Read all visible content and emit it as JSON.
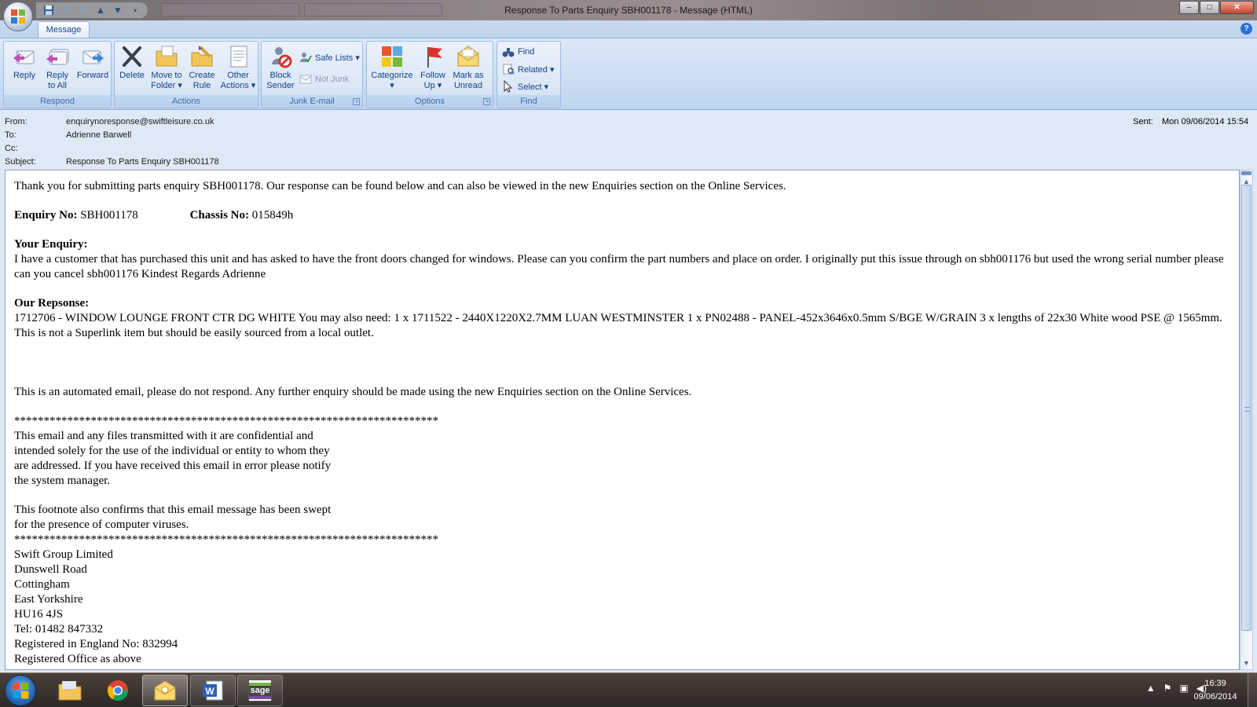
{
  "window": {
    "title": "Response To Parts Enquiry SBH001178 - Message (HTML)",
    "controls": {
      "minimize": "–",
      "maximize": "□",
      "close": "✕"
    }
  },
  "quick_access": {
    "icons": [
      "save-icon",
      "undo-icon",
      "redo-icon",
      "previous-item-icon",
      "next-item-icon",
      "customize-dropdown-icon"
    ]
  },
  "ribbon": {
    "tab": "Message",
    "help": "?",
    "groups": {
      "respond": {
        "label": "Respond",
        "reply": "Reply",
        "reply_all_1": "Reply",
        "reply_all_2": "to All",
        "forward": "Forward"
      },
      "actions": {
        "label": "Actions",
        "delete": "Delete",
        "move_1": "Move to",
        "move_2": "Folder ▾",
        "create_1": "Create",
        "create_2": "Rule",
        "other_1": "Other",
        "other_2": "Actions ▾"
      },
      "junk": {
        "label": "Junk E-mail",
        "block_1": "Block",
        "block_2": "Sender",
        "safe_lists": "Safe Lists ▾",
        "not_junk": "Not Junk"
      },
      "options": {
        "label": "Options",
        "categorize_1": "Categorize",
        "categorize_2": "▾",
        "follow_1": "Follow",
        "follow_2": "Up ▾",
        "mark_1": "Mark as",
        "mark_2": "Unread"
      },
      "find": {
        "label": "Find",
        "find": "Find",
        "related": "Related ▾",
        "select": "Select ▾"
      }
    }
  },
  "header": {
    "from_label": "From:",
    "from": "enquirynoresponse@swiftleisure.co.uk",
    "to_label": "To:",
    "to": "Adrienne Barwell",
    "cc_label": "Cc:",
    "cc": "",
    "subject_label": "Subject:",
    "subject": "Response To Parts Enquiry SBH001178",
    "sent_label": "Sent:",
    "sent": "Mon 09/06/2014 15:54"
  },
  "body": {
    "intro": "Thank you for submitting parts enquiry SBH001178. Our response can be found below and can also be viewed in the new Enquiries section on the Online Services.",
    "enquiry_no_label": "Enquiry No:",
    "enquiry_no": "SBH001178",
    "chassis_no_label": "Chassis No:",
    "chassis_no": "015849h",
    "your_enquiry_label": "Your Enquiry:",
    "your_enquiry": "I have a customer that has purchased this unit and has asked to have the front doors changed for windows. Please can you confirm the part numbers and place on order. I originally put this issue through on sbh001176 but used the wrong serial number please can you cancel sbh001176 Kindest Regards Adrienne",
    "response_label": "Our Repsonse:",
    "response": "1712706 - WINDOW LOUNGE FRONT CTR DG WHITE You may also need: 1 x 1711522 - 2440X1220X2.7MM LUAN WESTMINSTER 1 x PN02488 - PANEL-452x3646x0.5mm S/BGE W/GRAIN 3 x lengths of 22x30 White wood PSE @ 1565mm. This is not a Superlink item but should be easily sourced from a local outlet.",
    "automated": "This is an automated email, please do not respond. Any further enquiry should be made using the new Enquiries section on the Online Services.",
    "stars": "************************************************************************",
    "disclaimer_1": "This email and any files transmitted with it are confidential and",
    "disclaimer_2": "intended solely for the use of the individual or entity to whom they",
    "disclaimer_3": "are addressed. If you have received this email in error please notify",
    "disclaimer_4": "the system manager.",
    "footnote_1": "This footnote also confirms that this email message has been swept",
    "footnote_2": "for the presence of computer viruses.",
    "company": "Swift Group Limited",
    "addr_1": "Dunswell Road",
    "addr_2": "Cottingham",
    "addr_3": "East Yorkshire",
    "postcode": "HU16 4JS",
    "tel": "Tel: 01482 847332",
    "registered": "Registered in England No: 832994",
    "office": "Registered Office as above"
  },
  "taskbar": {
    "apps": [
      "windows-explorer-icon",
      "chrome-icon",
      "outlook-icon",
      "word-icon",
      "sage-icon"
    ],
    "sage_label": "sage",
    "word_label": "W",
    "time": "16:39",
    "date": "09/06/2014"
  },
  "colors": {
    "ribbon_text": "#15428b",
    "ribbon_bg": "#c9dbf2",
    "header_bg": "#dfe9f5"
  }
}
